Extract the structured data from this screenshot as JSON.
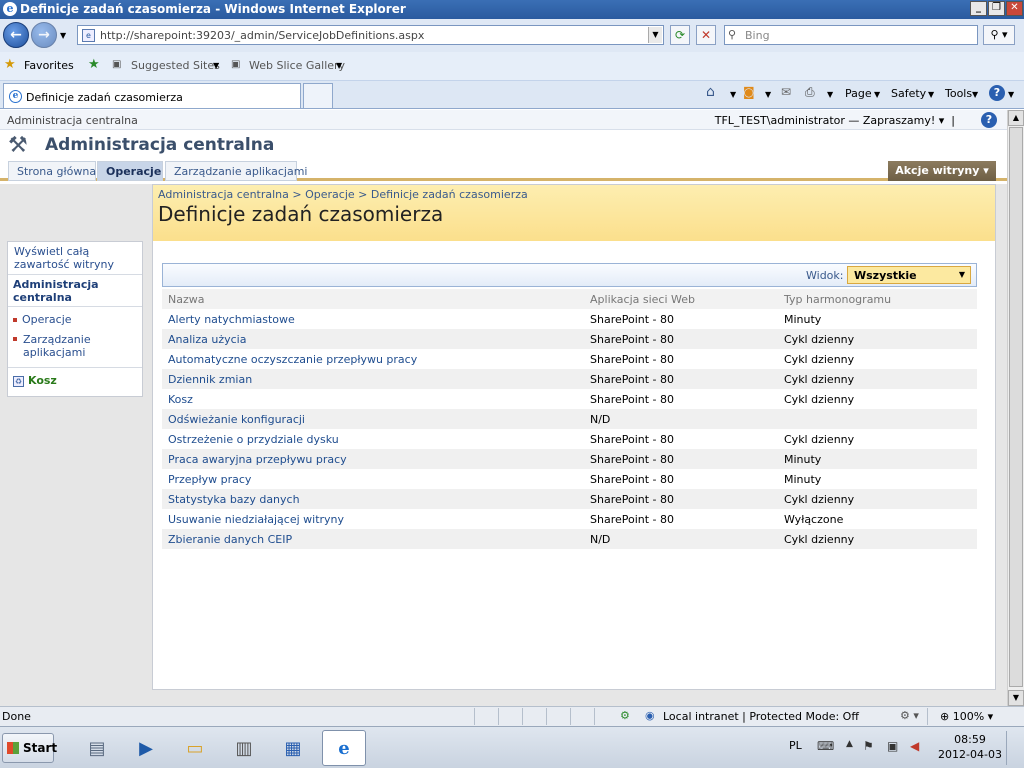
{
  "window": {
    "title": "Definicje zadań czasomierza - Windows Internet Explorer"
  },
  "browser": {
    "url": "http://sharepoint:39203/_admin/ServiceJobDefinitions.aspx",
    "search_placeholder": "Bing",
    "favorites_label": "Favorites",
    "suggested_sites": "Suggested Sites",
    "web_slice_gallery": "Web Slice Gallery",
    "tab_title": "Definicje zadań czasomierza",
    "commands": [
      "Page",
      "Safety",
      "Tools"
    ]
  },
  "sharepoint": {
    "top_left": "Administracja centralna",
    "user": "TFL_TEST\\administrator — Zapraszamy!",
    "site_title": "Administracja centralna",
    "nav_tabs": [
      "Strona główna",
      "Operacje",
      "Zarządzanie aplikacjami"
    ],
    "selected_tab": "Operacje",
    "site_actions": "Akcje witryny",
    "breadcrumb": "Administracja centralna > Operacje > Definicje zadań czasomierza",
    "page_title": "Definicje zadań czasomierza",
    "left_nav": {
      "view_all": "Wyświetl całą zawartość witryny",
      "header": "Administracja centralna",
      "items": [
        "Operacje",
        "Zarządzanie aplikacjami"
      ],
      "recycle_bin": "Kosz"
    },
    "view_label": "Widok:",
    "view_selected": "Wszystkie",
    "table": {
      "columns": [
        "Nazwa",
        "Aplikacja sieci Web",
        "Typ harmonogramu"
      ],
      "rows": [
        [
          "Alerty natychmiastowe",
          "SharePoint - 80",
          "Minuty"
        ],
        [
          "Analiza użycia",
          "SharePoint - 80",
          "Cykl dzienny"
        ],
        [
          "Automatyczne oczyszczanie przepływu pracy",
          "SharePoint - 80",
          "Cykl dzienny"
        ],
        [
          "Dziennik zmian",
          "SharePoint - 80",
          "Cykl dzienny"
        ],
        [
          "Kosz",
          "SharePoint - 80",
          "Cykl dzienny"
        ],
        [
          "Odświeżanie konfiguracji",
          "N/D",
          ""
        ],
        [
          "Ostrzeżenie o przydziale dysku",
          "SharePoint - 80",
          "Cykl dzienny"
        ],
        [
          "Praca awaryjna przepływu pracy",
          "SharePoint - 80",
          "Minuty"
        ],
        [
          "Przepływ pracy",
          "SharePoint - 80",
          "Minuty"
        ],
        [
          "Statystyka bazy danych",
          "SharePoint - 80",
          "Cykl dzienny"
        ],
        [
          "Usuwanie niedziałającej witryny",
          "SharePoint - 80",
          "Wyłączone"
        ],
        [
          "Zbieranie danych CEIP",
          "N/D",
          "Cykl dzienny"
        ]
      ]
    }
  },
  "statusbar": {
    "status": "Done",
    "zone": "Local intranet | Protected Mode: Off",
    "zoom": "100%"
  },
  "taskbar": {
    "start": "Start",
    "language": "PL",
    "time": "08:59",
    "date": "2012-04-03"
  }
}
